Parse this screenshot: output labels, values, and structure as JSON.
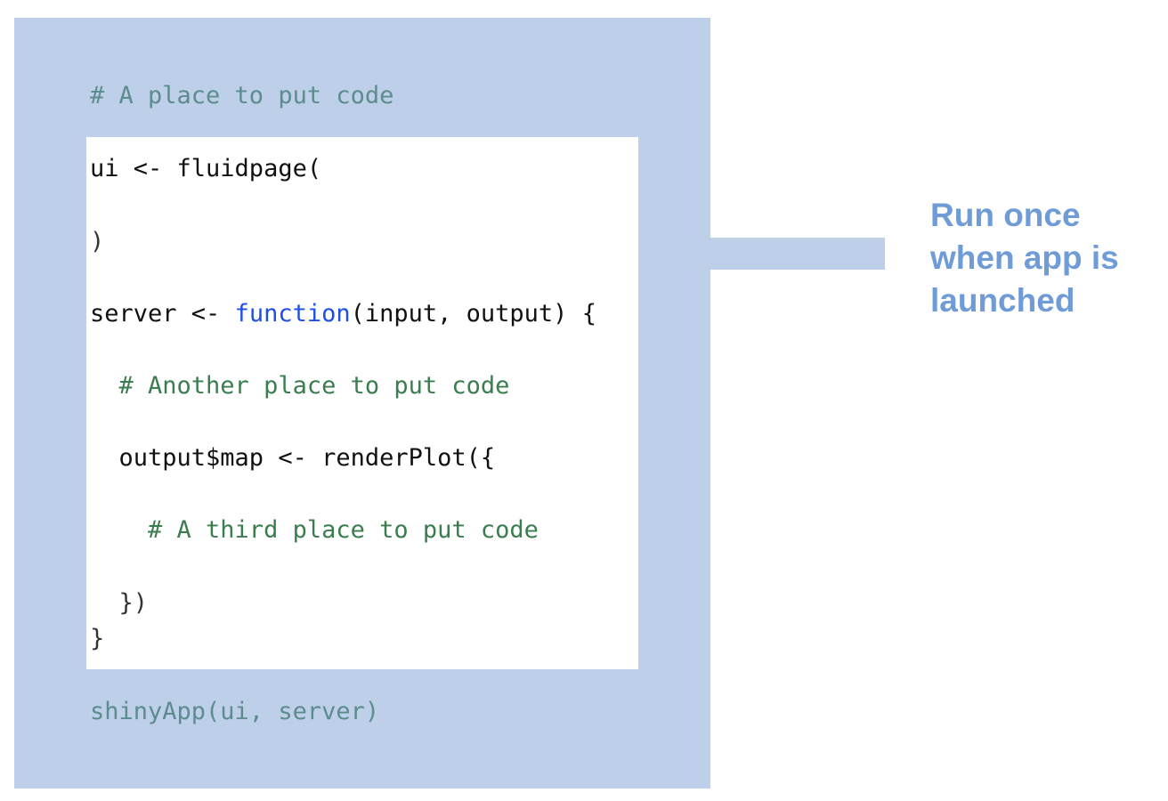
{
  "outer_comment": "# A place to put code",
  "code": {
    "ui_line": "ui <- fluidpage(",
    "ui_close": ")",
    "server_prefix": "server <- ",
    "server_keyword": "function",
    "server_suffix": "(input, output) {",
    "inner_comment": "  # Another place to put code",
    "output_line": "  output$map <- renderPlot({",
    "third_comment": "    # A third place to put code",
    "render_close": "  })",
    "server_close": "}"
  },
  "shiny_app_line": "shinyApp(ui, server)",
  "annotation": {
    "line1": "Run once",
    "line2": "when app is",
    "line3": "launched"
  },
  "colors": {
    "panel": "#bed0e9",
    "annotation_text": "#6f9bd6",
    "keyword": "#1f4fe6",
    "comment": "#3a7d4e"
  }
}
